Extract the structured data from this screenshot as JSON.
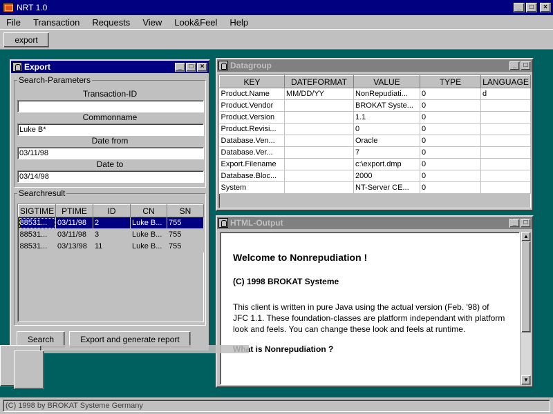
{
  "window": {
    "title": "NRT 1.0"
  },
  "menu": [
    "File",
    "Transaction",
    "Requests",
    "View",
    "Look&Feel",
    "Help"
  ],
  "toolbar": {
    "export_label": "export"
  },
  "export_frame": {
    "title": "Export",
    "search_params": {
      "legend": "Search-Parameters",
      "transaction_id_label": "Transaction-ID",
      "transaction_id_value": "",
      "commonname_label": "Commonname",
      "commonname_value": "Luke B*",
      "date_from_label": "Date from",
      "date_from_value": "03/11/98",
      "date_to_label": "Date to",
      "date_to_value": "03/14/98"
    },
    "searchresult": {
      "legend": "Searchresult",
      "columns": [
        "SIGTIME",
        "PTIME",
        "ID",
        "CN",
        "SN"
      ],
      "rows": [
        [
          "88531...",
          "03/11/98",
          "2",
          "Luke B...",
          "755"
        ],
        [
          "88531...",
          "03/11/98",
          "3",
          "Luke B...",
          "755"
        ],
        [
          "88531...",
          "03/13/98",
          "11",
          "Luke B...",
          "755"
        ]
      ],
      "selected_row": 0
    },
    "search_button": "Search",
    "export_report_button": "Export and generate report"
  },
  "datagroup_frame": {
    "title": "Datagroup",
    "columns": [
      "KEY",
      "DATEFORMAT",
      "VALUE",
      "TYPE",
      "LANGUAGE"
    ],
    "rows": [
      [
        "Product.Name",
        "MM/DD/YY",
        "NonRepudiati...",
        "0",
        "d"
      ],
      [
        "Product.Vendor",
        "",
        "BROKAT Syste...",
        "0",
        ""
      ],
      [
        "Product.Version",
        "",
        "1.1",
        "0",
        ""
      ],
      [
        "Product.Revisi...",
        "",
        "0",
        "0",
        ""
      ],
      [
        "Database.Ven...",
        "",
        "Oracle",
        "0",
        ""
      ],
      [
        "Database.Ver...",
        "",
        "7",
        "0",
        ""
      ],
      [
        "Export.Filename",
        "",
        "c:\\export.dmp",
        "0",
        ""
      ],
      [
        "Database.Bloc...",
        "",
        "2000",
        "0",
        ""
      ],
      [
        "System",
        "",
        "NT-Server CE...",
        "0",
        ""
      ]
    ]
  },
  "html_frame": {
    "title": "HTML-Output",
    "heading": "Welcome to Nonrepudiation !",
    "copyright": "(C) 1998 BROKAT Systeme",
    "paragraph": "This client is written in pure Java using the actual version (Feb. '98) of JFC 1.1. These foundation-classes are platform independant with platform look and feels. You can change these look and feels at runtime.",
    "question": "What is Nonrepudiation ?"
  },
  "status": {
    "text": "(C) 1998 by BROKAT Systeme Germany"
  }
}
